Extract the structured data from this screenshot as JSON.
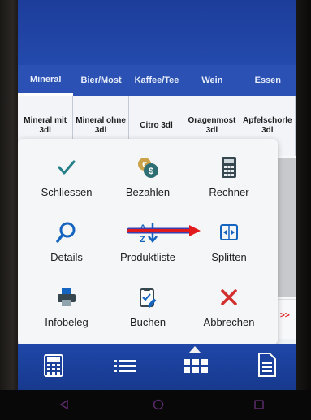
{
  "tabs": [
    {
      "label": "Mineral",
      "active": true
    },
    {
      "label": "Bier/Most",
      "active": false
    },
    {
      "label": "Kaffee/Tee",
      "active": false
    },
    {
      "label": "Wein",
      "active": false
    },
    {
      "label": "Essen",
      "active": false
    }
  ],
  "products": [
    "Mineral mit 3dl",
    "Mineral ohne 3dl",
    "Citro 3dl",
    "Oragenmost 3dl",
    "Apfelschorle 3dl"
  ],
  "more_indicator": ">>",
  "menu": {
    "items": [
      {
        "label": "Schliessen",
        "icon": "checkmark-icon"
      },
      {
        "label": "Bezahlen",
        "icon": "coins-icon"
      },
      {
        "label": "Rechner",
        "icon": "calculator-icon"
      },
      {
        "label": "Details",
        "icon": "magnifier-icon"
      },
      {
        "label": "Produktliste",
        "icon": "sort-list-icon"
      },
      {
        "label": "Splitten",
        "icon": "split-icon"
      },
      {
        "label": "Infobeleg",
        "icon": "printer-icon"
      },
      {
        "label": "Buchen",
        "icon": "clipboard-edit-icon"
      },
      {
        "label": "Abbrechen",
        "icon": "cancel-x-icon"
      }
    ]
  },
  "bottom_nav": [
    {
      "icon": "calculator-icon",
      "active": false
    },
    {
      "icon": "list-icon",
      "active": false
    },
    {
      "icon": "grid-menu-icon",
      "active": true
    },
    {
      "icon": "document-icon",
      "active": false
    }
  ],
  "colors": {
    "primary_blue": "#234aad",
    "accent_blue": "#1565c0",
    "danger_red": "#d32f2f",
    "check_teal": "#26808a",
    "annotation_arrow_red": "#e11b1b"
  }
}
